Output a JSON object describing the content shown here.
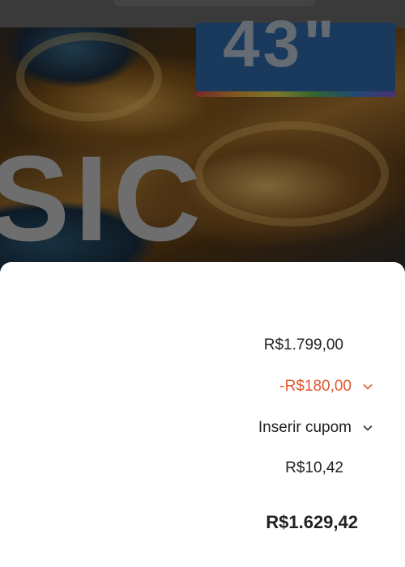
{
  "hero": {
    "size_text": "43\"",
    "brand_text": "SIC"
  },
  "summary": {
    "subtotal": "R$1.799,00",
    "discount": "-R$180,00",
    "coupon_label": "Inserir cupom",
    "shipping": "R$10,42",
    "total": "R$1.629,42"
  },
  "colors": {
    "discount": "#e4572e",
    "text": "#222222",
    "sheet": "#ffffff"
  }
}
